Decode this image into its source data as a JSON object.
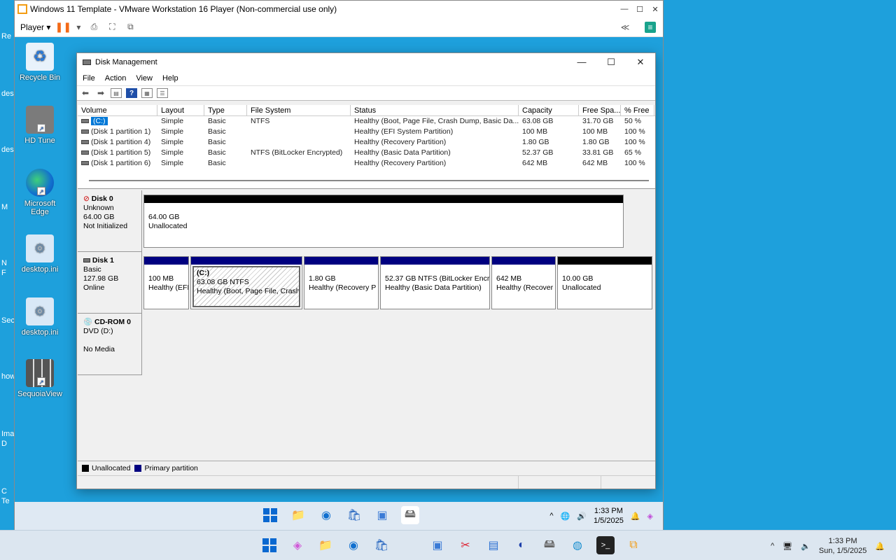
{
  "host": {
    "left_labels": [
      "Re",
      "des",
      "des",
      "M",
      "N",
      "F",
      "Sec",
      "how",
      "Ima",
      "D",
      "C",
      "Te"
    ],
    "taskbar": {
      "time": "1:33 PM",
      "date": "Sun, 1/5/2025"
    }
  },
  "vmware": {
    "title": "Windows 11 Template - VMware Workstation 16 Player (Non-commercial use only)",
    "player_menu": "Player"
  },
  "guest": {
    "desktop_icons": [
      {
        "label": "Recycle Bin"
      },
      {
        "label": "HD Tune"
      },
      {
        "label": "Microsoft Edge"
      },
      {
        "label": "desktop.ini"
      },
      {
        "label": "desktop.ini"
      },
      {
        "label": "SequoiaView"
      }
    ],
    "taskbar": {
      "time": "1:33 PM",
      "date": "1/5/2025"
    }
  },
  "disk_mgmt": {
    "title": "Disk Management",
    "menu": [
      "File",
      "Action",
      "View",
      "Help"
    ],
    "columns": [
      "Volume",
      "Layout",
      "Type",
      "File System",
      "Status",
      "Capacity",
      "Free Spa...",
      "% Free"
    ],
    "volumes": [
      [
        "(C:)",
        "Simple",
        "Basic",
        "NTFS",
        "Healthy (Boot, Page File, Crash Dump, Basic Da...",
        "63.08 GB",
        "31.70 GB",
        "50 %"
      ],
      [
        "(Disk 1 partition 1)",
        "Simple",
        "Basic",
        "",
        "Healthy (EFI System Partition)",
        "100 MB",
        "100 MB",
        "100 %"
      ],
      [
        "(Disk 1 partition 4)",
        "Simple",
        "Basic",
        "",
        "Healthy (Recovery Partition)",
        "1.80 GB",
        "1.80 GB",
        "100 %"
      ],
      [
        "(Disk 1 partition 5)",
        "Simple",
        "Basic",
        "NTFS (BitLocker Encrypted)",
        "Healthy (Basic Data Partition)",
        "52.37 GB",
        "33.81 GB",
        "65 %"
      ],
      [
        "(Disk 1 partition 6)",
        "Simple",
        "Basic",
        "",
        "Healthy (Recovery Partition)",
        "642 MB",
        "642 MB",
        "100 %"
      ]
    ],
    "disk0": {
      "name": "Disk 0",
      "type": "Unknown",
      "size": "64.00 GB",
      "state": "Not Initialized",
      "partition": {
        "line1": "64.00 GB",
        "line2": "Unallocated"
      }
    },
    "disk1": {
      "name": "Disk 1",
      "type": "Basic",
      "size": "127.98 GB",
      "state": "Online",
      "partitions": [
        {
          "title": "",
          "line1": "100 MB",
          "line2": "Healthy (EFI"
        },
        {
          "title": "(C:)",
          "line1": "63.08 GB NTFS",
          "line2": "Healthy (Boot, Page File, Crash"
        },
        {
          "title": "",
          "line1": "1.80 GB",
          "line2": "Healthy (Recovery P"
        },
        {
          "title": "",
          "line1": "52.37 GB NTFS (BitLocker Encry",
          "line2": "Healthy (Basic Data Partition)"
        },
        {
          "title": "",
          "line1": "642 MB",
          "line2": "Healthy (Recover"
        },
        {
          "title": "",
          "line1": "10.00 GB",
          "line2": "Unallocated"
        }
      ]
    },
    "cdrom": {
      "name": "CD-ROM 0",
      "type": "DVD (D:)",
      "media": "No Media"
    },
    "legend": {
      "unallocated": "Unallocated",
      "primary": "Primary partition"
    },
    "colors": {
      "primary": "#000080",
      "unallocated": "#000000",
      "selection": "#0078d7"
    }
  }
}
